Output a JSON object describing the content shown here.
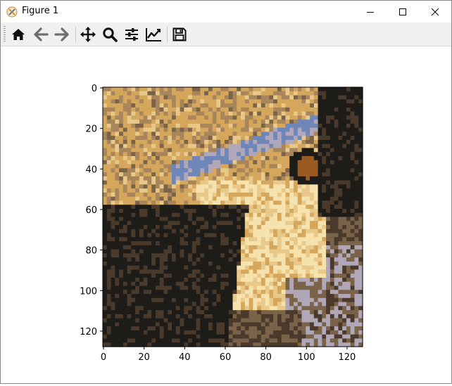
{
  "window": {
    "title": "Figure 1",
    "controls": [
      "minimize",
      "maximize",
      "close"
    ]
  },
  "toolbar": {
    "buttons": [
      {
        "name": "home",
        "icon": "home-icon"
      },
      {
        "name": "back",
        "icon": "arrow-left-icon"
      },
      {
        "name": "forward",
        "icon": "arrow-right-icon"
      },
      {
        "name": "pan",
        "icon": "move-icon"
      },
      {
        "name": "zoom",
        "icon": "magnifier-icon"
      },
      {
        "name": "configure-subplots",
        "icon": "sliders-icon"
      },
      {
        "name": "edit-axis",
        "icon": "line-chart-icon"
      },
      {
        "name": "save",
        "icon": "floppy-disk-icon"
      }
    ]
  },
  "plot": {
    "x_ticks": [
      "0",
      "20",
      "40",
      "60",
      "80",
      "100",
      "120"
    ],
    "y_ticks": [
      "0",
      "20",
      "40",
      "60",
      "80",
      "100",
      "120"
    ],
    "palette": [
      "#1e1c18",
      "#4a3a2c",
      "#7a6348",
      "#a8855a",
      "#d4a75c",
      "#e8c98a",
      "#f6e2ad",
      "#6f86b8",
      "#b0a7b8",
      "#9a5a22"
    ]
  },
  "chart_data": {
    "type": "heatmap",
    "description_image": "mandrill face color-quantized image",
    "x_range": [
      0,
      127
    ],
    "y_range": [
      127,
      0
    ],
    "xticks": [
      0,
      20,
      40,
      60,
      80,
      100,
      120
    ],
    "yticks": [
      0,
      20,
      40,
      60,
      80,
      100,
      120
    ]
  }
}
